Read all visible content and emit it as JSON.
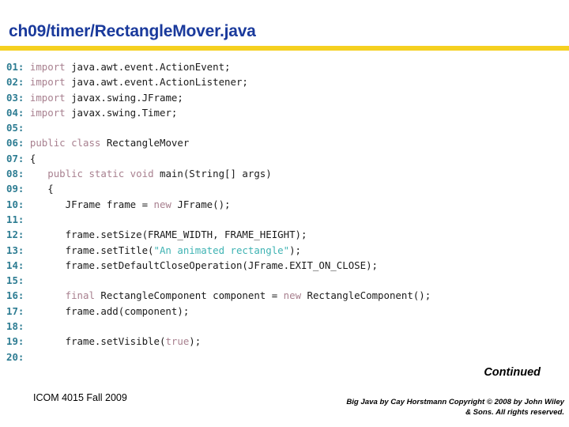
{
  "slide": {
    "title": "ch09/timer/RectangleMover.java",
    "accent_color": "#f5d020",
    "title_color": "#1a3a9c"
  },
  "code": {
    "line_number_color": "#2d7c92",
    "keyword_color": "#a8808f",
    "string_color": "#3fb3b3",
    "text_color": "#1a1a1a",
    "lines": [
      {
        "num": "01:",
        "tokens": [
          {
            "t": "kw",
            "v": "import"
          },
          {
            "t": "pl",
            "v": " java.awt.event.ActionEvent;"
          }
        ]
      },
      {
        "num": "02:",
        "tokens": [
          {
            "t": "kw",
            "v": "import"
          },
          {
            "t": "pl",
            "v": " java.awt.event.ActionListener;"
          }
        ]
      },
      {
        "num": "03:",
        "tokens": [
          {
            "t": "kw",
            "v": "import"
          },
          {
            "t": "pl",
            "v": " javax.swing.JFrame;"
          }
        ]
      },
      {
        "num": "04:",
        "tokens": [
          {
            "t": "kw",
            "v": "import"
          },
          {
            "t": "pl",
            "v": " javax.swing.Timer;"
          }
        ]
      },
      {
        "num": "05:",
        "tokens": []
      },
      {
        "num": "06:",
        "tokens": [
          {
            "t": "kw",
            "v": "public class"
          },
          {
            "t": "pl",
            "v": " RectangleMover"
          }
        ]
      },
      {
        "num": "07:",
        "tokens": [
          {
            "t": "pl",
            "v": "{"
          }
        ]
      },
      {
        "num": "08:",
        "tokens": [
          {
            "t": "pl",
            "v": "   "
          },
          {
            "t": "kw",
            "v": "public static void"
          },
          {
            "t": "pl",
            "v": " main(String[] args)"
          }
        ]
      },
      {
        "num": "09:",
        "tokens": [
          {
            "t": "pl",
            "v": "   {"
          }
        ]
      },
      {
        "num": "10:",
        "tokens": [
          {
            "t": "pl",
            "v": "      JFrame frame = "
          },
          {
            "t": "kw",
            "v": "new"
          },
          {
            "t": "pl",
            "v": " JFrame();"
          }
        ]
      },
      {
        "num": "11:",
        "tokens": []
      },
      {
        "num": "12:",
        "tokens": [
          {
            "t": "pl",
            "v": "      frame.setSize(FRAME_WIDTH, FRAME_HEIGHT);"
          }
        ]
      },
      {
        "num": "13:",
        "tokens": [
          {
            "t": "pl",
            "v": "      frame.setTitle("
          },
          {
            "t": "str",
            "v": "\"An animated rectangle\""
          },
          {
            "t": "pl",
            "v": ");"
          }
        ]
      },
      {
        "num": "14:",
        "tokens": [
          {
            "t": "pl",
            "v": "      frame.setDefaultCloseOperation(JFrame.EXIT_ON_CLOSE);"
          }
        ]
      },
      {
        "num": "15:",
        "tokens": []
      },
      {
        "num": "16:",
        "tokens": [
          {
            "t": "pl",
            "v": "      "
          },
          {
            "t": "kw",
            "v": "final"
          },
          {
            "t": "pl",
            "v": " RectangleComponent component = "
          },
          {
            "t": "kw",
            "v": "new"
          },
          {
            "t": "pl",
            "v": " RectangleComponent();"
          }
        ]
      },
      {
        "num": "17:",
        "tokens": [
          {
            "t": "pl",
            "v": "      frame.add(component);"
          }
        ]
      },
      {
        "num": "18:",
        "tokens": []
      },
      {
        "num": "19:",
        "tokens": [
          {
            "t": "pl",
            "v": "      frame.setVisible("
          },
          {
            "t": "kw",
            "v": "true"
          },
          {
            "t": "pl",
            "v": ");"
          }
        ]
      },
      {
        "num": "20:",
        "tokens": []
      }
    ]
  },
  "continued_label": "Continued",
  "footer": {
    "left": "ICOM 4015 Fall 2009",
    "right_line1": "Big Java by Cay Horstmann Copyright © 2008 by John Wiley",
    "right_line2": "& Sons.  All rights reserved."
  }
}
